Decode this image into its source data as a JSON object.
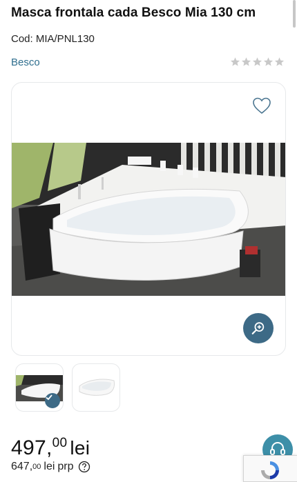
{
  "product": {
    "title": "Masca frontala cada Besco Mia 130 cm",
    "code": "Cod: MIA/PNL130",
    "brand": "Besco",
    "rating_stars": 0,
    "rating_max": 5
  },
  "gallery": {
    "favorite_icon": "heart-outline-icon",
    "zoom_icon": "zoom-in-icon",
    "thumbnails": [
      {
        "name": "bath-in-room-thumbnail",
        "selected": true
      },
      {
        "name": "bath-white-thumbnail",
        "selected": false
      }
    ]
  },
  "pricing": {
    "price_int": "497,",
    "price_dec": "00",
    "price_currency": "lei",
    "old_int": "647,",
    "old_dec": "00",
    "old_currency": "lei",
    "old_label": "prp"
  },
  "widgets": {
    "support_icon": "headset-icon",
    "recaptcha_icon": "recaptcha-icon"
  },
  "colors": {
    "accent": "#3d6a86",
    "link": "#2e6e8e",
    "star_empty": "#c8c8c8"
  }
}
